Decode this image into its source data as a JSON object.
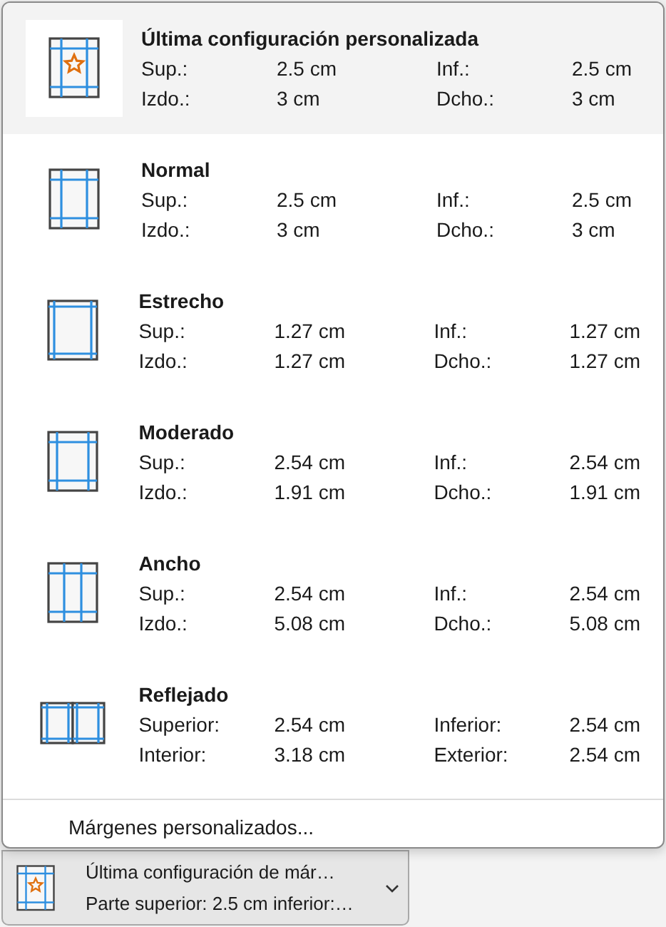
{
  "menu": {
    "items": [
      {
        "kind": "custom",
        "selected": true,
        "title": "Última configuración personalizada",
        "fields": [
          {
            "label": "Sup.:",
            "value": "2.5 cm"
          },
          {
            "label": "Inf.:",
            "value": "2.5 cm"
          },
          {
            "label": "Izdo.:",
            "value": "3 cm"
          },
          {
            "label": "Dcho.:",
            "value": "3 cm"
          }
        ]
      },
      {
        "kind": "normal",
        "selected": false,
        "title": "Normal",
        "fields": [
          {
            "label": "Sup.:",
            "value": "2.5 cm"
          },
          {
            "label": "Inf.:",
            "value": "2.5 cm"
          },
          {
            "label": "Izdo.:",
            "value": "3 cm"
          },
          {
            "label": "Dcho.:",
            "value": "3 cm"
          }
        ]
      },
      {
        "kind": "narrow",
        "selected": false,
        "title": "Estrecho",
        "fields": [
          {
            "label": "Sup.:",
            "value": "1.27 cm"
          },
          {
            "label": "Inf.:",
            "value": "1.27 cm"
          },
          {
            "label": "Izdo.:",
            "value": "1.27 cm"
          },
          {
            "label": "Dcho.:",
            "value": "1.27 cm"
          }
        ]
      },
      {
        "kind": "moderate",
        "selected": false,
        "title": "Moderado",
        "fields": [
          {
            "label": "Sup.:",
            "value": "2.54 cm"
          },
          {
            "label": "Inf.:",
            "value": "2.54 cm"
          },
          {
            "label": "Izdo.:",
            "value": "1.91 cm"
          },
          {
            "label": "Dcho.:",
            "value": "1.91 cm"
          }
        ]
      },
      {
        "kind": "wide",
        "selected": false,
        "title": "Ancho",
        "fields": [
          {
            "label": "Sup.:",
            "value": "2.54 cm"
          },
          {
            "label": "Inf.:",
            "value": "2.54 cm"
          },
          {
            "label": "Izdo.:",
            "value": "5.08 cm"
          },
          {
            "label": "Dcho.:",
            "value": "5.08 cm"
          }
        ]
      },
      {
        "kind": "mirrored",
        "selected": false,
        "title": "Reflejado",
        "fields": [
          {
            "label": "Superior:",
            "value": "2.54 cm"
          },
          {
            "label": "Inferior:",
            "value": "2.54 cm"
          },
          {
            "label": "Interior:",
            "value": "3.18 cm"
          },
          {
            "label": "Exterior:",
            "value": "2.54 cm"
          }
        ]
      }
    ],
    "custom_margins": "Márgenes personalizados..."
  },
  "margins_button": {
    "kind": "custom",
    "line_1": "Última configuración de már…",
    "line_2": "Parte superior: 2.5 cm inferior:…"
  }
}
